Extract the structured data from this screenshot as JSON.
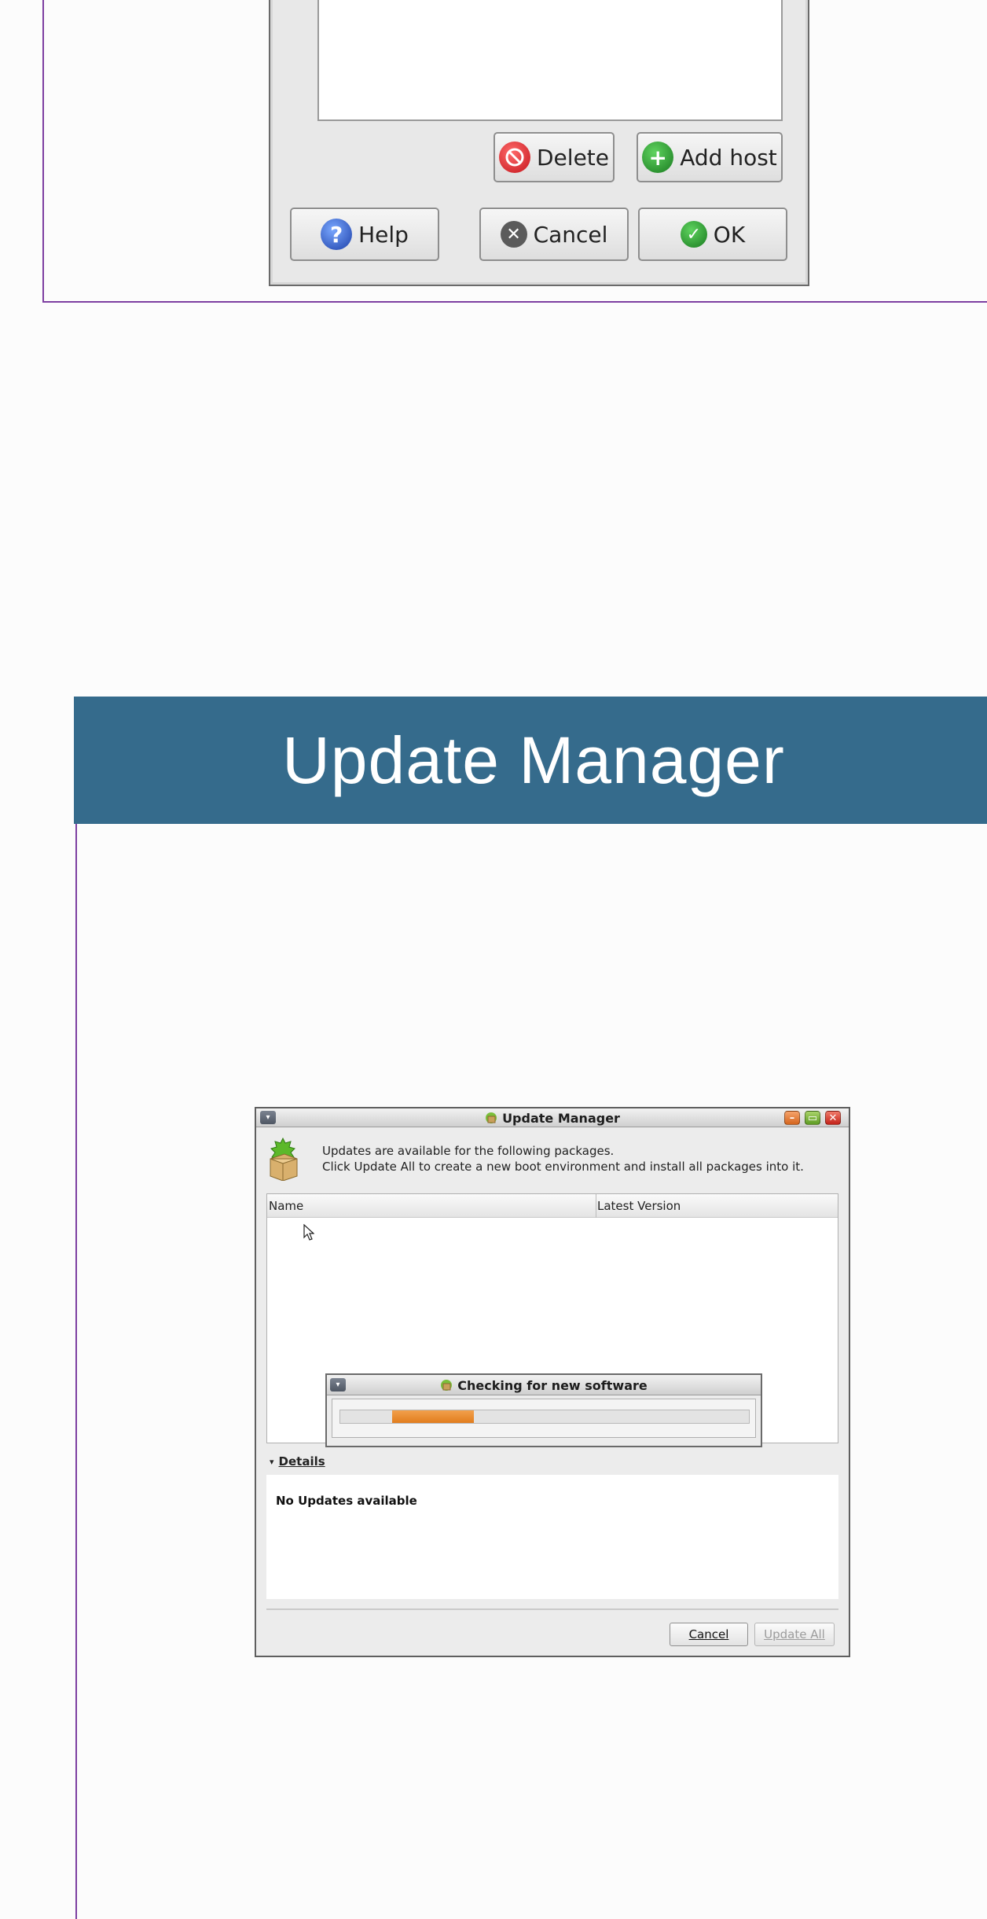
{
  "top_dialog": {
    "delete_label": "Delete",
    "add_host_label": "Add host",
    "help_label": "Help",
    "cancel_label": "Cancel",
    "ok_label": "OK"
  },
  "banner": {
    "title": "Update Manager"
  },
  "update_manager": {
    "window_title": "Update Manager",
    "info_line1": "Updates are available for the following packages.",
    "info_line2": "Click Update All to create a new boot environment and install all packages into it.",
    "columns": [
      "Name",
      "Latest Version"
    ],
    "progress_title": "Checking for new software",
    "progress_fraction": 0.2,
    "details_label": "Details",
    "details_message": "No Updates available",
    "cancel_label": "Cancel",
    "update_all_label": "Update All"
  },
  "colors": {
    "banner_bg": "#356b8c",
    "frame_line": "#7d3fa1",
    "progress_fill": "#e27d1d"
  }
}
